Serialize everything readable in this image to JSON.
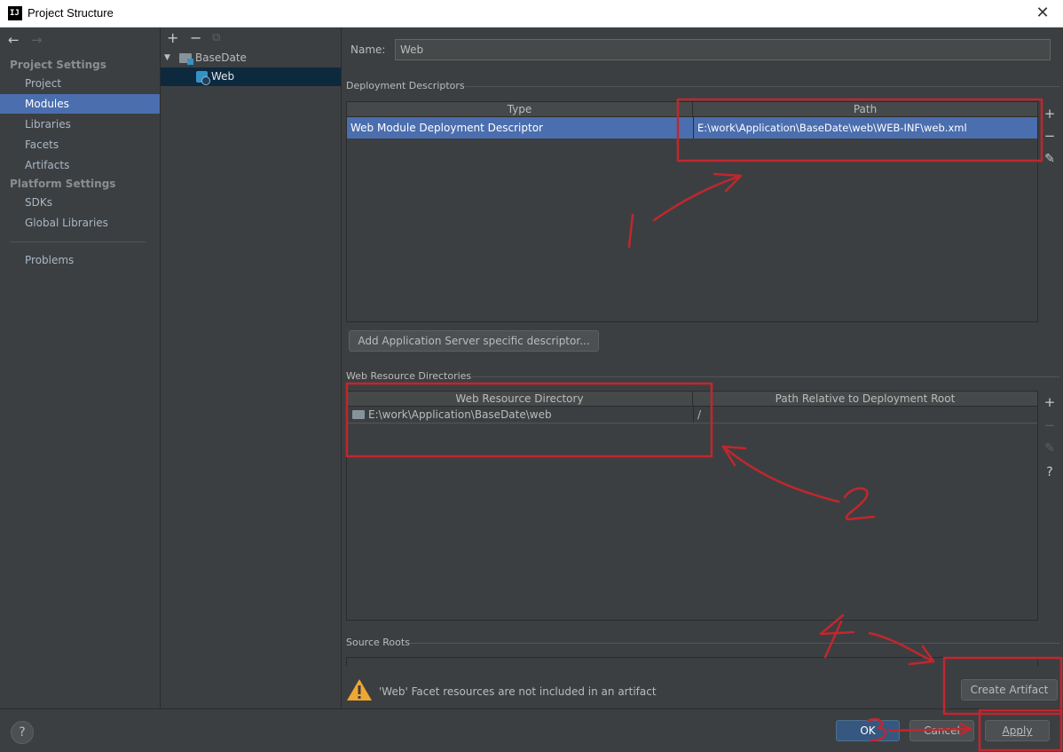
{
  "window": {
    "title": "Project Structure",
    "close_glyph": "✕",
    "app_icon_text": "IJ"
  },
  "left_nav": {
    "back_glyph": "←",
    "forward_glyph": "→",
    "project_settings_label": "Project Settings",
    "project_settings_items": [
      {
        "label": "Project",
        "selected": false
      },
      {
        "label": "Modules",
        "selected": true
      },
      {
        "label": "Libraries",
        "selected": false
      },
      {
        "label": "Facets",
        "selected": false
      },
      {
        "label": "Artifacts",
        "selected": false
      }
    ],
    "platform_settings_label": "Platform Settings",
    "platform_settings_items": [
      {
        "label": "SDKs"
      },
      {
        "label": "Global Libraries"
      }
    ],
    "problems_label": "Problems"
  },
  "module_tree": {
    "add_glyph": "+",
    "remove_glyph": "−",
    "copy_glyph": "⧉",
    "root": {
      "label": "BaseDate",
      "expanded": true
    },
    "child": {
      "label": "Web",
      "selected": true
    }
  },
  "facet": {
    "name_label": "Name:",
    "name_value": "Web",
    "deployment_descriptors": {
      "label": "Deployment Descriptors",
      "columns": [
        "Type",
        "Path"
      ],
      "rows": [
        {
          "type": "Web Module Deployment Descriptor",
          "path": "E:\\work\\Application\\BaseDate\\web\\WEB-INF\\web.xml",
          "selected": true
        }
      ],
      "add_server_descriptor_button": "Add Application Server specific descriptor..."
    },
    "web_resource_directories": {
      "label": "Web Resource Directories",
      "columns": [
        "Web Resource Directory",
        "Path Relative to Deployment Root"
      ],
      "rows": [
        {
          "directory": "E:\\work\\Application\\BaseDate\\web",
          "relative_path": "/"
        }
      ]
    },
    "source_roots": {
      "label": "Source Roots"
    },
    "warning": {
      "text": "'Web' Facet resources are not included in an artifact",
      "fix_button": "Create Artifact"
    }
  },
  "side_tools": {
    "add_glyph": "+",
    "remove_glyph": "−",
    "edit_glyph": "✎",
    "help_glyph": "?"
  },
  "footer": {
    "help_glyph": "?",
    "ok_button": "OK",
    "cancel_button": "Cancel",
    "apply_button": "Apply"
  },
  "annotations": {
    "color": "#c1272d",
    "labels": [
      "1",
      "2",
      "3",
      "4"
    ]
  }
}
